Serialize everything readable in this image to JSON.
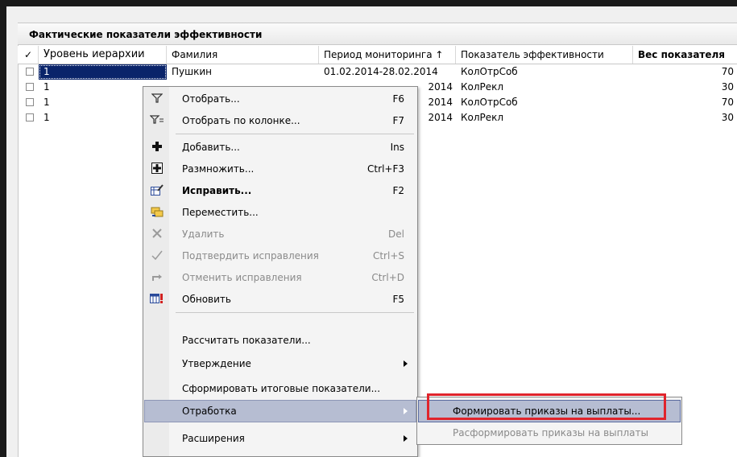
{
  "grid": {
    "title": "Фактические показатели эффективности",
    "columns": {
      "check": "✓",
      "level": "Уровень иерархии",
      "surname": "Фамилия",
      "period": "Период мониторинга ↑",
      "indicator": "Показатель эффективности",
      "weight": "Вес показателя"
    },
    "rows": [
      {
        "level": "1",
        "surname": "Пушкин",
        "period": "01.02.2014-28.02.2014",
        "indicator": "КолОтрСоб",
        "weight": "70"
      },
      {
        "level": "1",
        "surname": "",
        "period": "2014",
        "indicator": "КолРекл",
        "weight": "30"
      },
      {
        "level": "1",
        "surname": "",
        "period": "2014",
        "indicator": "КолОтрСоб",
        "weight": "70"
      },
      {
        "level": "1",
        "surname": "",
        "period": "2014",
        "indicator": "КолРекл",
        "weight": "30"
      }
    ]
  },
  "context_menu": {
    "items": [
      {
        "label": "Отобрать...",
        "shortcut": "F6",
        "icon": "filter-icon"
      },
      {
        "label": "Отобрать по колонке...",
        "shortcut": "F7",
        "icon": "filter-column-icon"
      },
      {
        "label": "Добавить...",
        "shortcut": "Ins",
        "icon": "add-icon"
      },
      {
        "label": "Размножить...",
        "shortcut": "Ctrl+F3",
        "icon": "duplicate-icon"
      },
      {
        "label": "Исправить...",
        "shortcut": "F2",
        "icon": "edit-icon"
      },
      {
        "label": "Переместить...",
        "shortcut": "",
        "icon": "move-icon"
      },
      {
        "label": "Удалить",
        "shortcut": "Del",
        "icon": "delete-icon"
      },
      {
        "label": "Подтвердить исправления",
        "shortcut": "Ctrl+S",
        "icon": "confirm-icon"
      },
      {
        "label": "Отменить исправления",
        "shortcut": "Ctrl+D",
        "icon": "undo-icon"
      },
      {
        "label": "Обновить",
        "shortcut": "F5",
        "icon": "refresh-icon"
      },
      {
        "label": "Рассчитать показатели..."
      },
      {
        "label": "Утверждение"
      },
      {
        "label": "Сформировать итоговые показатели..."
      },
      {
        "label": "Отработка"
      },
      {
        "label": "Расширения"
      }
    ]
  },
  "submenu": {
    "items": [
      {
        "label": "Формировать приказы на выплаты..."
      },
      {
        "label": "Расформировать приказы на выплаты"
      }
    ]
  },
  "colors": {
    "highlight": "#b6bdd2",
    "selection": "#0a246a",
    "callout": "#e0242c"
  }
}
